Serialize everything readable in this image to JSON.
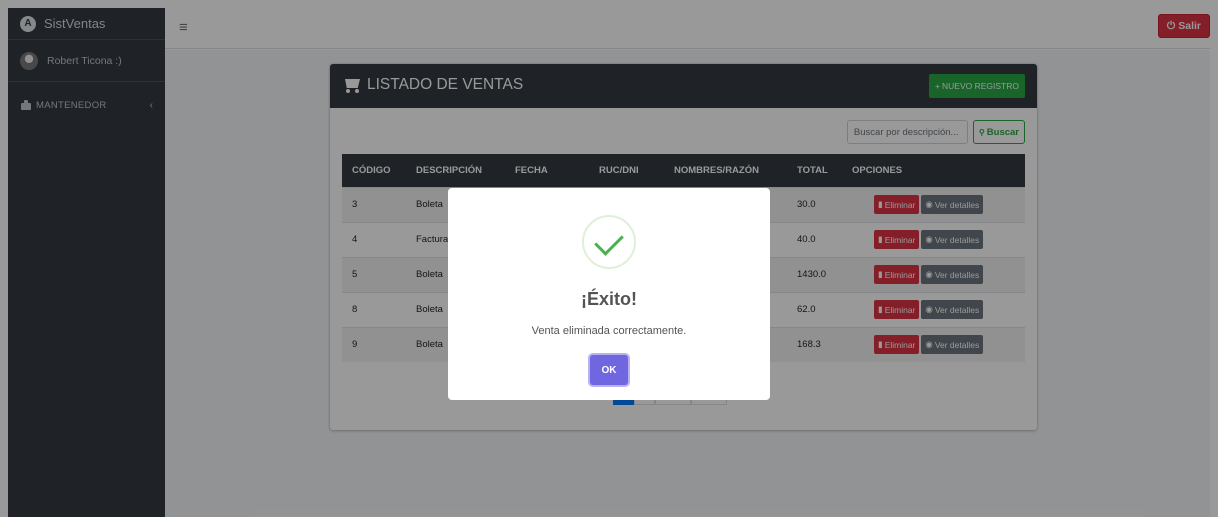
{
  "sidebar": {
    "brand": "SistVentas",
    "brand_logo": "A",
    "user_name": "Robert Ticona :)",
    "nav_items": [
      {
        "label": "MANTENEDOR",
        "icon": "puzzle-icon",
        "chevron": "‹"
      }
    ]
  },
  "topbar": {
    "menu_icon": "≡",
    "logout_label": "Salir",
    "logout_icon": "⏻"
  },
  "card": {
    "title": "LISTADO DE VENTAS",
    "new_label": "NUEVO REGISTRO",
    "new_icon": "+",
    "search_placeholder": "Buscar por descripción...",
    "search_label": "Buscar",
    "search_icon": "🔍"
  },
  "table": {
    "headers": [
      "CÓDIGO",
      "DESCRIPCIÓN",
      "FECHA",
      "RUC/DNI",
      "NOMBRES/RAZÓN",
      "TOTAL",
      "OPCIONES"
    ],
    "rows": [
      {
        "codigo": "3",
        "descripcion": "Boleta",
        "total": "30.0"
      },
      {
        "codigo": "4",
        "descripcion": "Factura",
        "total": "40.0"
      },
      {
        "codigo": "5",
        "descripcion": "Boleta",
        "total": "1430.0"
      },
      {
        "codigo": "8",
        "descripcion": "Boleta",
        "total": "62.0"
      },
      {
        "codigo": "9",
        "descripcion": "Boleta",
        "total": "168.3"
      }
    ],
    "delete_label": "Eliminar",
    "details_label": "Ver detalles"
  },
  "modal": {
    "title": "¡Éxito!",
    "message": "Venta eliminada correctamente.",
    "ok_label": "OK",
    "icon": "check-icon"
  },
  "colors": {
    "sidebar_bg": "#343a40",
    "logout": "#dc3545",
    "new_button": "#28a745",
    "delete_button": "#dc3545",
    "details_button": "#6c757d",
    "ok_button": "#7066e0",
    "success": "#4caf50"
  }
}
